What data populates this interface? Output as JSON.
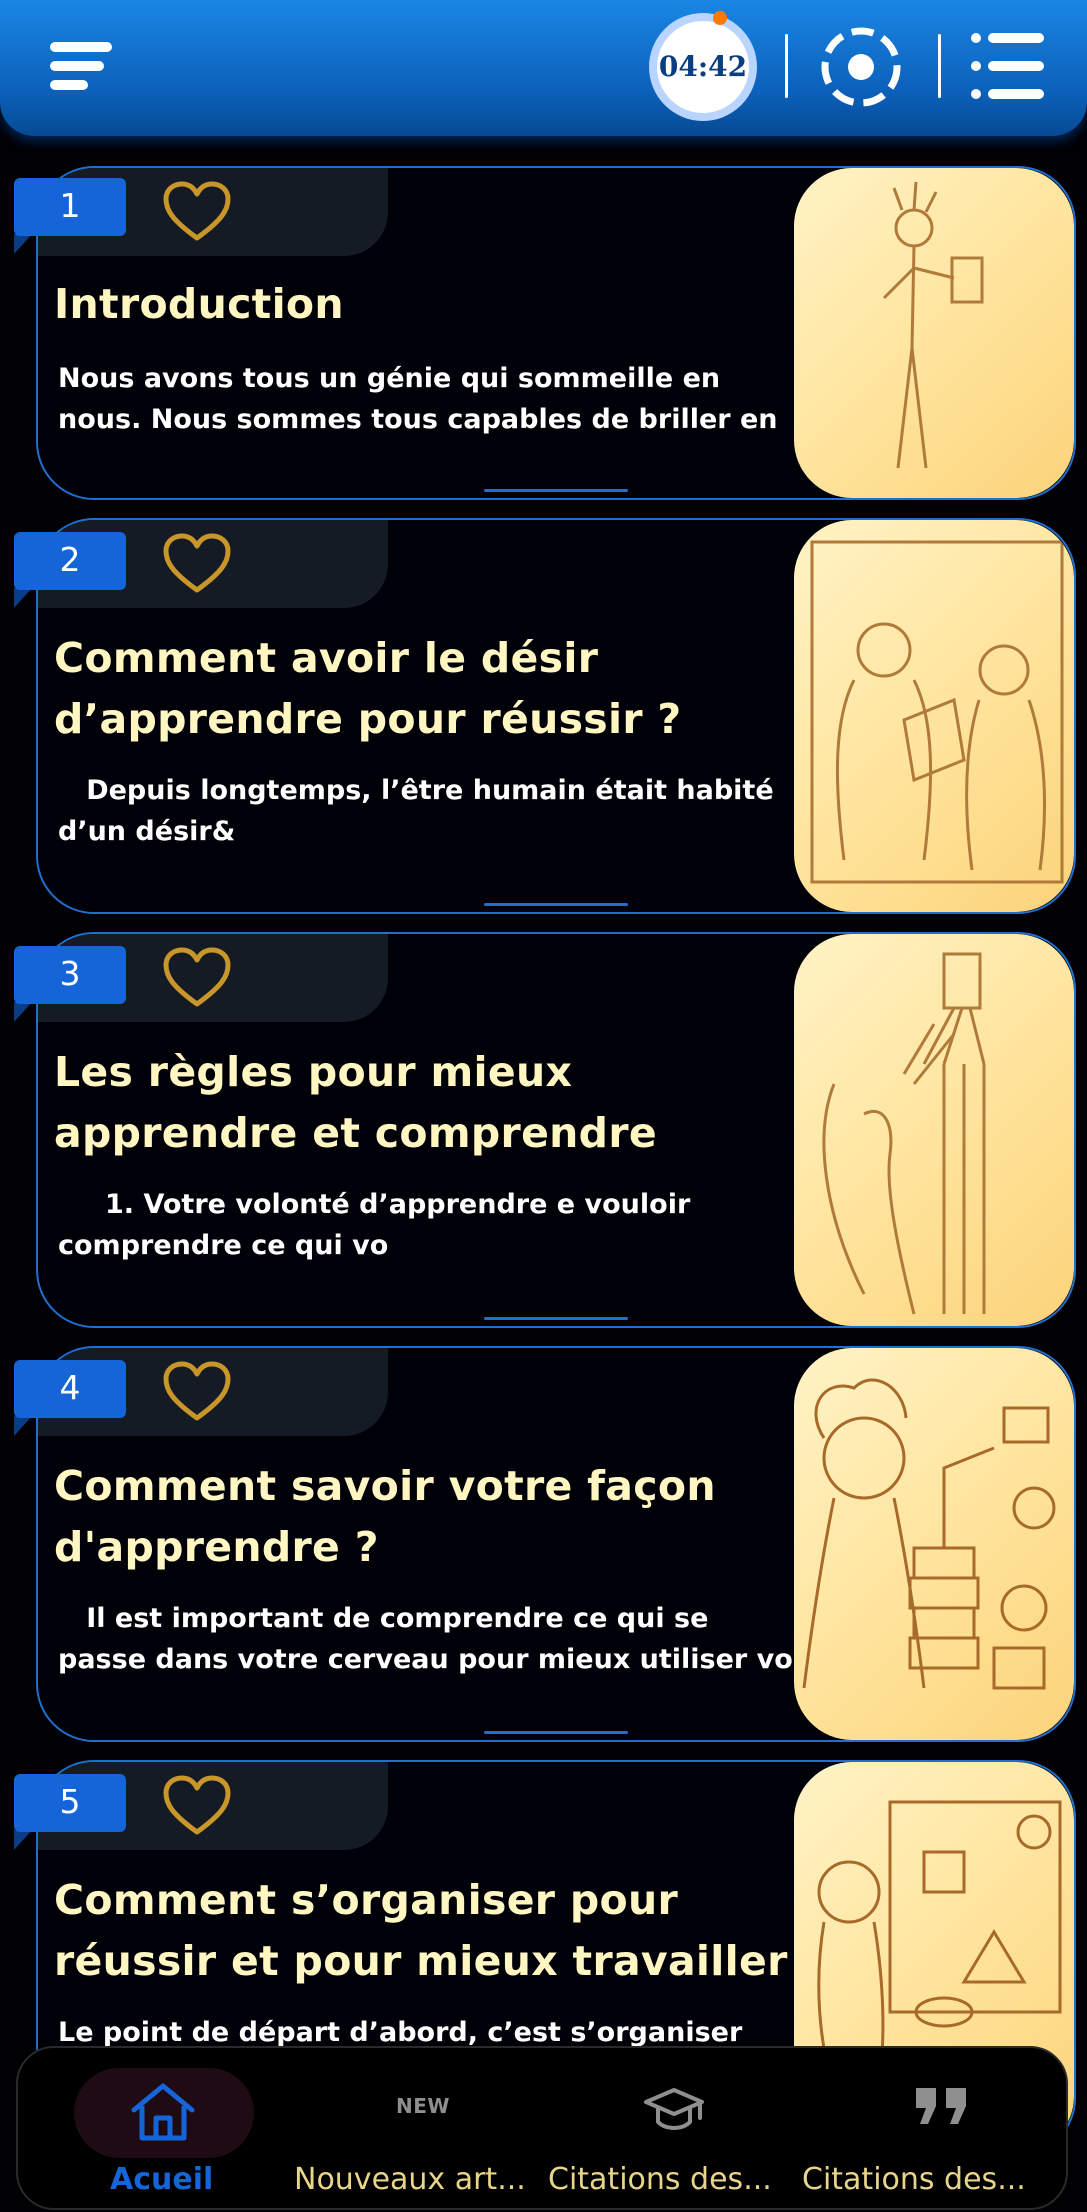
{
  "header": {
    "timer": "04:42",
    "menu_icon": "hamburger-menu-icon",
    "target_icon": "crosshair-target-icon",
    "list_icon": "list-icon",
    "colors": {
      "bar": "#0b5fb8",
      "timer_progress": "#ff7a00"
    }
  },
  "articles": [
    {
      "number": "1",
      "title": "Introduction",
      "excerpt": "Nous avons tous un génie qui sommeille en\nnous. Nous sommes tous capables de briller en",
      "favorite_icon": "heart-outline-icon"
    },
    {
      "number": "2",
      "title": "Comment avoir le désir d’apprendre pour réussir ?",
      "excerpt": "   Depuis longtemps, l’être humain était habité\nd’un désir&",
      "favorite_icon": "heart-outline-icon"
    },
    {
      "number": "3",
      "title": "Les règles pour mieux apprendre et comprendre",
      "excerpt": "     1. Votre volonté d’apprendre e vouloir\ncomprendre ce qui vo",
      "favorite_icon": "heart-outline-icon"
    },
    {
      "number": "4",
      "title": "Comment savoir votre façon d'apprendre ?",
      "excerpt": "   Il est important de comprendre ce qui se\npasse dans votre cerveau pour mieux utiliser vos",
      "favorite_icon": "heart-outline-icon"
    },
    {
      "number": "5",
      "title": "Comment s’organiser pour réussir et pour mieux travailler",
      "excerpt": "Le point de départ d’abord, c’est s’organiser",
      "favorite_icon": "heart-outline-icon"
    }
  ],
  "bottom_nav": {
    "items": [
      {
        "label": "Acueil",
        "icon": "home-icon",
        "active": true
      },
      {
        "label": "Nouveaux art...",
        "icon": "new-badge-icon",
        "badge": "NEW",
        "active": false
      },
      {
        "label": "Citations des...",
        "icon": "graduation-cap-icon",
        "active": false
      },
      {
        "label": "Citations des...",
        "icon": "quote-icon",
        "active": false
      }
    ],
    "colors": {
      "active": "#1565d8",
      "inactive": "#e8d58a"
    }
  },
  "colors": {
    "title": "#fff6c2",
    "card_border": "#1f6fd0",
    "heart": "#c9962a",
    "badge": "#1565d8"
  }
}
